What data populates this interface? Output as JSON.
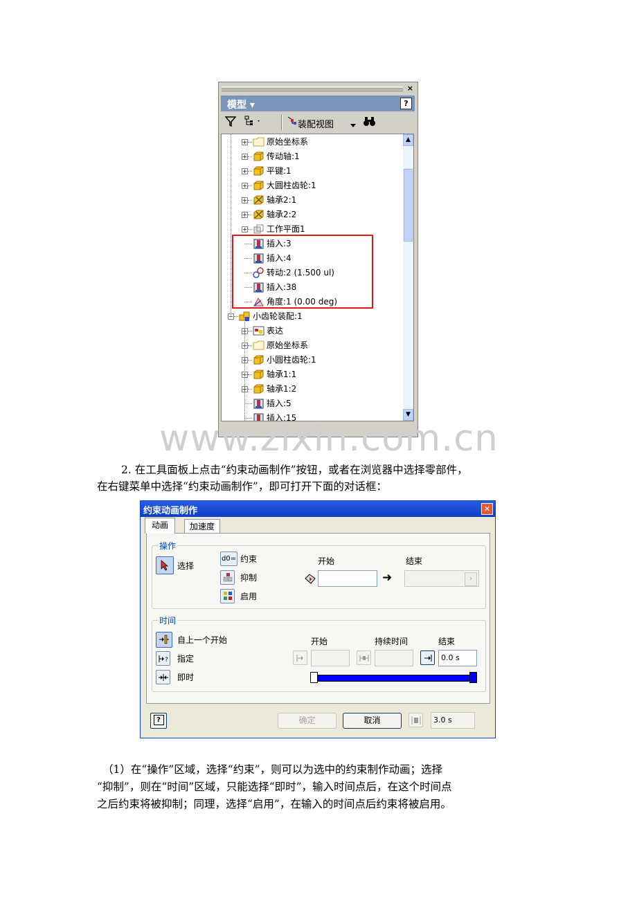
{
  "panel": {
    "title": "模型 ▾",
    "help": "?",
    "close": "×",
    "view_label": "装配视图",
    "tree": [
      {
        "label": "原始坐标系",
        "icon": "folder-icon",
        "expand": "+",
        "depth": 1
      },
      {
        "label": "传动轴:1",
        "icon": "part-icon",
        "expand": "+",
        "depth": 1
      },
      {
        "label": "平键:1",
        "icon": "part-icon",
        "expand": "+",
        "depth": 1
      },
      {
        "label": "大圆柱齿轮:1",
        "icon": "part-icon",
        "expand": "+",
        "depth": 1
      },
      {
        "label": "轴承2:1",
        "icon": "bearing-icon",
        "expand": "+",
        "depth": 1
      },
      {
        "label": "轴承2:2",
        "icon": "bearing-icon",
        "expand": "+",
        "depth": 1
      },
      {
        "label": "工作平面1",
        "icon": "workplane-icon",
        "expand": "+",
        "depth": 1
      },
      {
        "label": "插入:3",
        "icon": "insert-constraint-icon",
        "expand": "",
        "depth": 1
      },
      {
        "label": "插入:4",
        "icon": "insert-constraint-icon",
        "expand": "",
        "depth": 1
      },
      {
        "label": "转动:2 (1.500 ul)",
        "icon": "rotation-constraint-icon",
        "expand": "",
        "depth": 1
      },
      {
        "label": "插入:38",
        "icon": "insert-constraint-icon",
        "expand": "",
        "depth": 1
      },
      {
        "label": "角度:1 (0.00 deg)",
        "icon": "angle-constraint-icon",
        "expand": "",
        "depth": 1
      },
      {
        "label": "小齿轮装配:1",
        "icon": "subassembly-icon",
        "expand": "−",
        "depth": 0
      },
      {
        "label": "表达",
        "icon": "representation-icon",
        "expand": "+",
        "depth": 1
      },
      {
        "label": "原始坐标系",
        "icon": "folder-icon",
        "expand": "+",
        "depth": 1
      },
      {
        "label": "小圆柱齿轮:1",
        "icon": "part-icon",
        "expand": "+",
        "depth": 1
      },
      {
        "label": "轴承1:1",
        "icon": "part-icon",
        "expand": "+",
        "depth": 1
      },
      {
        "label": "轴承1:2",
        "icon": "part-icon",
        "expand": "+",
        "depth": 1
      },
      {
        "label": "插入:5",
        "icon": "insert-constraint-icon",
        "expand": "",
        "depth": 1
      },
      {
        "label": "插入:15",
        "icon": "insert-constraint-icon",
        "expand": "",
        "depth": 1
      }
    ]
  },
  "watermark": "www.zixin.com.cn",
  "para1_line1": "2. 在工具面板上点击“约束动画制作”按钮，或者在浏览器中选择零部件，",
  "para1_line2": "在右键菜单中选择“约束动画制作”，即可打开下面的对话框：",
  "dialog": {
    "title": "约束动画制作",
    "tabs": [
      "动画",
      "加速度"
    ],
    "operation": {
      "group": "操作",
      "select": "选择",
      "constraint": "约束",
      "constraint_icon_text": "d0=",
      "suppress": "抑制",
      "enable": "启用",
      "start": "开始",
      "end": "结束",
      "arrow": "➜"
    },
    "time": {
      "group": "时间",
      "from_previous": "自上一个开始",
      "specify": "指定",
      "immediate": "即时",
      "start": "开始",
      "duration": "持续时间",
      "end": "结束",
      "end_value": "0.0 s"
    },
    "ok": "确定",
    "cancel": "取消",
    "total_time": "3.0 s",
    "help": "?"
  },
  "para2_line1": "（1）在“操作”区域，选择“约束”，则可以为选中的约束制作动画；选择",
  "para2_line2": "“抑制”，则在“时间”区域，只能选择“即时”，输入时间点后，在这个时间点",
  "para2_line3": "之后约束将被抑制；同理，选择“启用”，在输入的时间点后约束将被启用。"
}
